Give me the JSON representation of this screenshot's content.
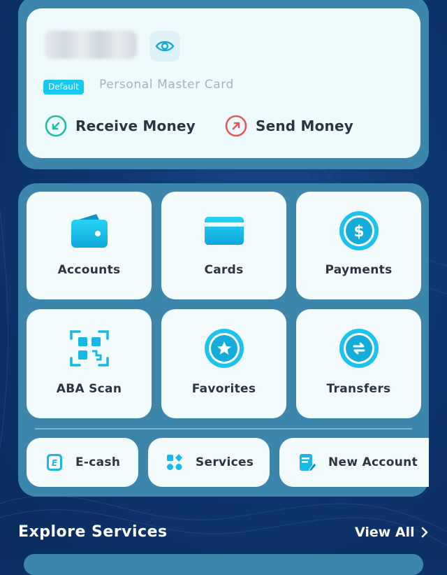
{
  "balance_card": {
    "eye_icon": "eye-icon",
    "badge": "Default",
    "card_name": "Personal Master Card",
    "receive_label": "Receive Money",
    "send_label": "Send Money",
    "receive_color": "#1fbfa5",
    "send_color": "#e25a5a"
  },
  "menu": {
    "tiles": [
      {
        "label": "Accounts",
        "icon": "wallet-icon"
      },
      {
        "label": "Cards",
        "icon": "card-icon"
      },
      {
        "label": "Payments",
        "icon": "dollar-icon"
      },
      {
        "label": "ABA Scan",
        "icon": "qr-scan-icon"
      },
      {
        "label": "Favorites",
        "icon": "star-icon"
      },
      {
        "label": "Transfers",
        "icon": "transfer-icon"
      }
    ],
    "quick": [
      {
        "label": "E-cash",
        "icon": "ecash-icon"
      },
      {
        "label": "Services",
        "icon": "services-icon"
      },
      {
        "label": "New Account",
        "icon": "new-account-icon"
      }
    ]
  },
  "explore": {
    "title": "Explore Services",
    "view_all": "View All"
  },
  "colors": {
    "background": "#0e3670",
    "panel": "#3c86ab",
    "accent": "#17c9f0",
    "text": "#2a3542"
  }
}
